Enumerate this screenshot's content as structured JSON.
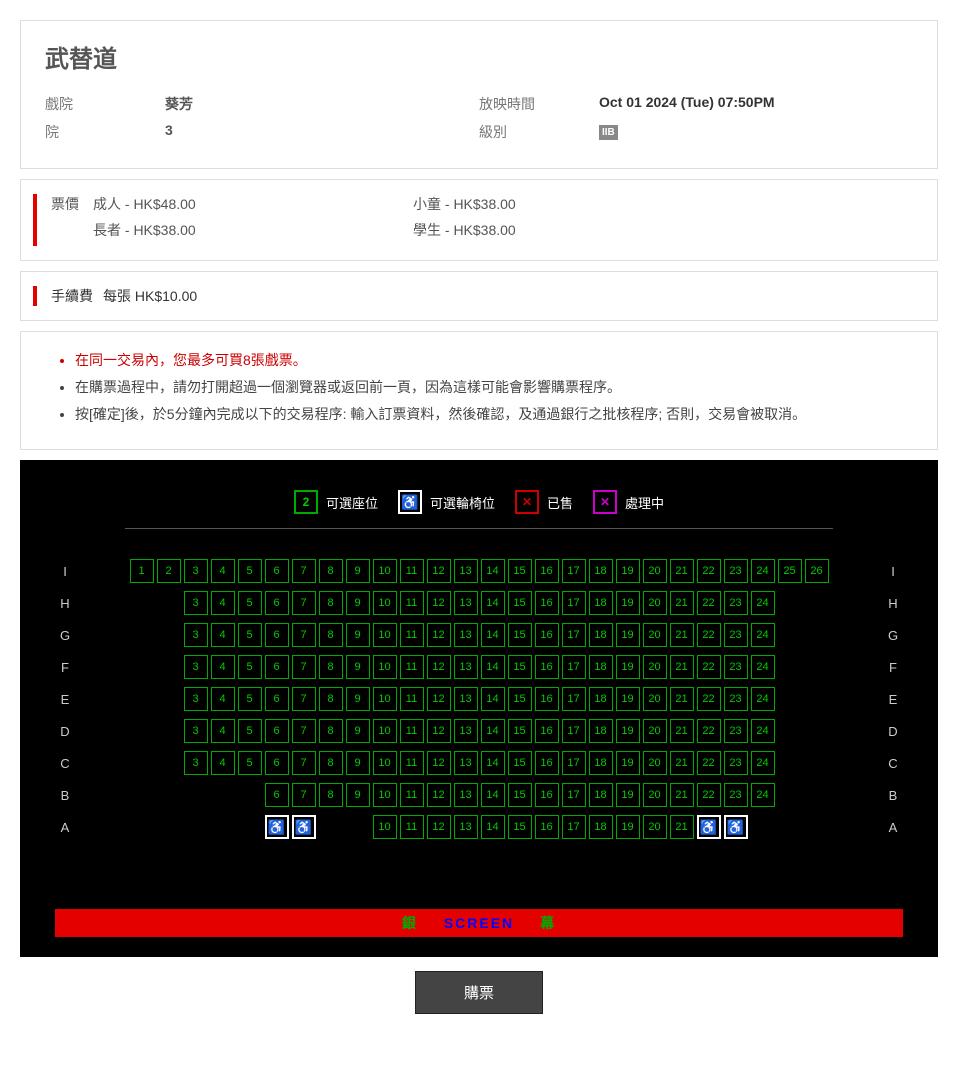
{
  "movie": {
    "title": "武替道"
  },
  "info": {
    "cinema_label": "戲院",
    "cinema_value": "葵芳",
    "house_label": "院",
    "house_value": "3",
    "time_label": "放映時間",
    "time_value": "Oct 01 2024 (Tue) 07:50PM",
    "rating_label": "級別",
    "rating_value": "IIB"
  },
  "pricing": {
    "label": "票價",
    "items": [
      {
        "text": "成人 - HK$48.00"
      },
      {
        "text": "小童 - HK$38.00"
      },
      {
        "text": "長者 - HK$38.00"
      },
      {
        "text": "學生 - HK$38.00"
      }
    ]
  },
  "fee": {
    "label": "手續費",
    "text": "每張 HK$10.00"
  },
  "notices": [
    {
      "text": "在同一交易內，您最多可買8張戲票。",
      "red": true
    },
    {
      "text": "在購票過程中，請勿打開超過一個瀏覽器或返回前一頁，因為這樣可能會影響購票程序。",
      "red": false
    },
    {
      "text": "按[確定]後，於5分鐘內完成以下的交易程序: 輸入訂票資料，然後確認，及通過銀行之批核程序; 否則，交易會被取消。",
      "red": false
    }
  ],
  "legend": {
    "avail_sample": "2",
    "avail_label": "可選座位",
    "wheel_label": "可選輪椅位",
    "sold_label": "已售",
    "proc_label": "處理中"
  },
  "rows": [
    {
      "label": "I",
      "pre": 0,
      "seats": [
        1,
        2,
        3,
        4,
        5,
        6,
        7,
        8,
        9,
        10,
        11,
        12,
        13,
        14,
        15,
        16,
        17,
        18,
        19,
        20,
        21,
        22,
        23,
        24,
        25,
        26
      ],
      "post": 0
    },
    {
      "label": "H",
      "pre": 2,
      "seats": [
        3,
        4,
        5,
        6,
        7,
        8,
        9,
        10,
        11,
        12,
        13,
        14,
        15,
        16,
        17,
        18,
        19,
        20,
        21,
        22,
        23,
        24
      ],
      "post": 2
    },
    {
      "label": "G",
      "pre": 2,
      "seats": [
        3,
        4,
        5,
        6,
        7,
        8,
        9,
        10,
        11,
        12,
        13,
        14,
        15,
        16,
        17,
        18,
        19,
        20,
        21,
        22,
        23,
        24
      ],
      "post": 2
    },
    {
      "label": "F",
      "pre": 2,
      "seats": [
        3,
        4,
        5,
        6,
        7,
        8,
        9,
        10,
        11,
        12,
        13,
        14,
        15,
        16,
        17,
        18,
        19,
        20,
        21,
        22,
        23,
        24
      ],
      "post": 2
    },
    {
      "label": "E",
      "pre": 2,
      "seats": [
        3,
        4,
        5,
        6,
        7,
        8,
        9,
        10,
        11,
        12,
        13,
        14,
        15,
        16,
        17,
        18,
        19,
        20,
        21,
        22,
        23,
        24
      ],
      "post": 2
    },
    {
      "label": "D",
      "pre": 2,
      "seats": [
        3,
        4,
        5,
        6,
        7,
        8,
        9,
        10,
        11,
        12,
        13,
        14,
        15,
        16,
        17,
        18,
        19,
        20,
        21,
        22,
        23,
        24
      ],
      "post": 2
    },
    {
      "label": "C",
      "pre": 2,
      "seats": [
        3,
        4,
        5,
        6,
        7,
        8,
        9,
        10,
        11,
        12,
        13,
        14,
        15,
        16,
        17,
        18,
        19,
        20,
        21,
        22,
        23,
        24
      ],
      "post": 2
    },
    {
      "label": "B",
      "pre": 5,
      "seats": [
        6,
        7,
        8,
        9,
        10,
        11,
        12,
        13,
        14,
        15,
        16,
        17,
        18,
        19,
        20,
        21,
        22,
        23,
        24
      ],
      "post": 2
    },
    {
      "label": "A",
      "pre": 5,
      "wheels_pre": 2,
      "gap": 2,
      "seats": [
        10,
        11,
        12,
        13,
        14,
        15,
        16,
        17,
        18,
        19,
        20,
        21
      ],
      "wheels_post": 2,
      "post": 3
    }
  ],
  "screen": {
    "cn1": "銀",
    "en": "SCREEN",
    "cn2": "幕"
  },
  "buy": {
    "label": "購票"
  }
}
